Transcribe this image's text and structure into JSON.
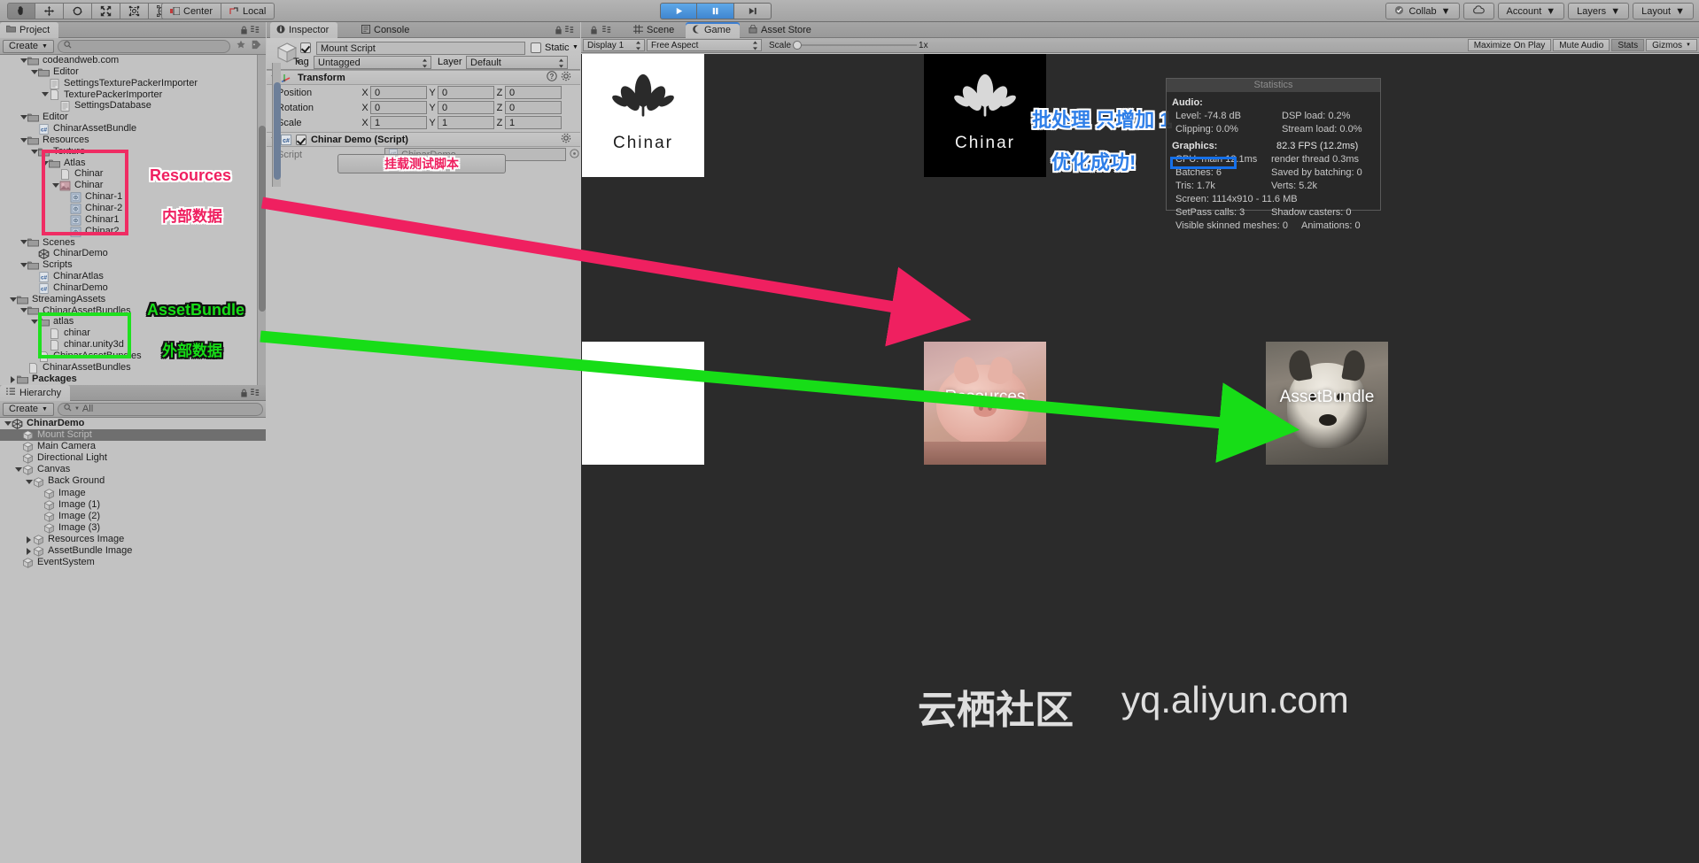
{
  "toolbar": {
    "transform_tools": [
      "hand-tool",
      "move-tool",
      "rotate-tool",
      "scale-tool",
      "rect-tool",
      "transform-tool"
    ],
    "pivot_label": "Center",
    "space_label": "Local",
    "play_label": "▶",
    "pause_label": "❙❙",
    "step_label": "▶❙",
    "collab_label": "Collab",
    "account_label": "Account",
    "layers_label": "Layers",
    "layout_label": "Layout"
  },
  "project": {
    "tab_label": "Project",
    "create_label": "Create",
    "search_placeholder": "",
    "tree": [
      {
        "label": "codeandweb.com",
        "indent": 1,
        "icon": "folder-icon",
        "tri": "down"
      },
      {
        "label": "Editor",
        "indent": 2,
        "icon": "folder-icon",
        "tri": "down"
      },
      {
        "label": "SettingsTexturePackerImporter",
        "indent": 3,
        "icon": "text-file-icon",
        "tri": ""
      },
      {
        "label": "TexturePackerImporter",
        "indent": 3,
        "icon": "file-icon",
        "tri": "down"
      },
      {
        "label": "SettingsDatabase",
        "indent": 4,
        "icon": "text-file-icon",
        "tri": ""
      },
      {
        "label": "Editor",
        "indent": 1,
        "icon": "folder-icon",
        "tri": "down"
      },
      {
        "label": "ChinarAssetBundle",
        "indent": 2,
        "icon": "csharp-icon",
        "tri": ""
      },
      {
        "label": "Resources",
        "indent": 1,
        "icon": "folder-icon",
        "tri": "down"
      },
      {
        "label": "Texture",
        "indent": 2,
        "icon": "folder-icon",
        "tri": "down"
      },
      {
        "label": "Atlas",
        "indent": 3,
        "icon": "folder-icon",
        "tri": "down"
      },
      {
        "label": "Chinar",
        "indent": 4,
        "icon": "file-icon",
        "tri": ""
      },
      {
        "label": "Chinar",
        "indent": 4,
        "icon": "sprite-atlas-icon",
        "tri": "down"
      },
      {
        "label": "Chinar-1",
        "indent": 5,
        "icon": "sprite-icon",
        "tri": ""
      },
      {
        "label": "Chinar-2",
        "indent": 5,
        "icon": "sprite-icon",
        "tri": ""
      },
      {
        "label": "Chinar1",
        "indent": 5,
        "icon": "sprite-icon",
        "tri": ""
      },
      {
        "label": "Chinar2",
        "indent": 5,
        "icon": "sprite-icon",
        "tri": ""
      },
      {
        "label": "Scenes",
        "indent": 1,
        "icon": "folder-icon",
        "tri": "down"
      },
      {
        "label": "ChinarDemo",
        "indent": 2,
        "icon": "unity-scene-icon",
        "tri": ""
      },
      {
        "label": "Scripts",
        "indent": 1,
        "icon": "folder-icon",
        "tri": "down"
      },
      {
        "label": "ChinarAtlas",
        "indent": 2,
        "icon": "csharp-icon",
        "tri": ""
      },
      {
        "label": "ChinarDemo",
        "indent": 2,
        "icon": "csharp-icon",
        "tri": ""
      },
      {
        "label": "StreamingAssets",
        "indent": 0,
        "icon": "folder-icon",
        "tri": "down"
      },
      {
        "label": "ChinarAssetBundles",
        "indent": 1,
        "icon": "folder-icon",
        "tri": "down"
      },
      {
        "label": "atlas",
        "indent": 2,
        "icon": "folder-icon",
        "tri": "down"
      },
      {
        "label": "chinar",
        "indent": 3,
        "icon": "file-icon",
        "tri": ""
      },
      {
        "label": "chinar.unity3d",
        "indent": 3,
        "icon": "file-icon",
        "tri": ""
      },
      {
        "label": "ChinarAssetBundles",
        "indent": 2,
        "icon": "file-icon",
        "tri": ""
      },
      {
        "label": "ChinarAssetBundles",
        "indent": 1,
        "icon": "file-icon",
        "tri": ""
      },
      {
        "label": "Packages",
        "indent": 0,
        "icon": "folder-icon",
        "tri": "right",
        "bold": true
      }
    ]
  },
  "hierarchy": {
    "tab_label": "Hierarchy",
    "create_label": "Create",
    "search_value": "All",
    "tree": [
      {
        "label": "ChinarDemo",
        "indent": 0,
        "icon": "unity-scene-icon",
        "tri": "down",
        "bold": true
      },
      {
        "label": "Mount Script",
        "indent": 1,
        "icon": "gameobject-icon",
        "tri": "",
        "selected": true
      },
      {
        "label": "Main Camera",
        "indent": 1,
        "icon": "gameobject-icon",
        "tri": ""
      },
      {
        "label": "Directional Light",
        "indent": 1,
        "icon": "gameobject-icon",
        "tri": ""
      },
      {
        "label": "Canvas",
        "indent": 1,
        "icon": "gameobject-icon",
        "tri": "down"
      },
      {
        "label": "Back Ground",
        "indent": 2,
        "icon": "gameobject-icon",
        "tri": "down"
      },
      {
        "label": "Image",
        "indent": 3,
        "icon": "gameobject-icon",
        "tri": ""
      },
      {
        "label": "Image (1)",
        "indent": 3,
        "icon": "gameobject-icon",
        "tri": ""
      },
      {
        "label": "Image (2)",
        "indent": 3,
        "icon": "gameobject-icon",
        "tri": ""
      },
      {
        "label": "Image (3)",
        "indent": 3,
        "icon": "gameobject-icon",
        "tri": ""
      },
      {
        "label": "Resources Image",
        "indent": 2,
        "icon": "gameobject-icon",
        "tri": "right"
      },
      {
        "label": "AssetBundle Image",
        "indent": 2,
        "icon": "gameobject-icon",
        "tri": "right"
      },
      {
        "label": "EventSystem",
        "indent": 1,
        "icon": "gameobject-icon",
        "tri": ""
      }
    ]
  },
  "inspector": {
    "tab_label": "Inspector",
    "console_tab_label": "Console",
    "object_name": "Mount Script",
    "static_label": "Static",
    "tag_label": "Tag",
    "tag_value": "Untagged",
    "layer_label": "Layer",
    "layer_value": "Default",
    "transform": {
      "title": "Transform",
      "rows": [
        {
          "label": "Position",
          "x": "0",
          "y": "0",
          "z": "0"
        },
        {
          "label": "Rotation",
          "x": "0",
          "y": "0",
          "z": "0"
        },
        {
          "label": "Scale",
          "x": "1",
          "y": "1",
          "z": "1"
        }
      ]
    },
    "script_component": {
      "title": "Chinar Demo (Script)",
      "script_label": "Script",
      "script_value": "ChinarDemo"
    }
  },
  "gameview": {
    "scene_tab": "Scene",
    "game_tab": "Game",
    "assetstore_tab": "Asset Store",
    "display_label": "Display 1",
    "aspect_label": "Free Aspect",
    "scale_label": "Scale",
    "scale_value": "1x",
    "maximize_label": "Maximize On Play",
    "mute_label": "Mute Audio",
    "stats_label": "Stats",
    "gizmos_label": "Gizmos",
    "logo_text": "Chinar",
    "resources_caption": "Resources",
    "assetbundle_caption": "AssetBundle"
  },
  "statistics": {
    "title": "Statistics",
    "audio_header": "Audio:",
    "level": "Level: -74.8 dB",
    "clipping": "Clipping: 0.0%",
    "dsp_load": "DSP load: 0.2%",
    "stream_load": "Stream load: 0.0%",
    "graphics_header": "Graphics:",
    "fps": "82.3 FPS (12.2ms)",
    "cpu_main": "CPU: main 12.1ms",
    "render_thread": "render thread 0.3ms",
    "batches": "Batches: 6",
    "saved_by_batching": "Saved by batching: 0",
    "tris": "Tris: 1.7k",
    "verts": "Verts: 5.2k",
    "screen": "Screen: 1114x910 - 11.6 MB",
    "setpass": "SetPass calls: 3",
    "shadow_casters": "Shadow casters: 0",
    "skinned": "Visible skinned meshes: 0",
    "animations": "Animations: 0"
  },
  "annotations": {
    "resources_label": "Resources",
    "internal_data_label": "内部数据",
    "assetbundle_label": "AssetBundle",
    "external_data_label": "外部数据",
    "mount_script_button": "挂载测试脚本",
    "batch_line1": "批处理 只增加 1",
    "batch_line2": "优化成功!"
  },
  "watermark": {
    "cn": "云栖社区",
    "url": "yq.aliyun.com"
  },
  "colors": {
    "pink": "#ef2060",
    "green": "#17dd17",
    "blue": "#2f7fe8",
    "accent": "#3d7fd1"
  }
}
